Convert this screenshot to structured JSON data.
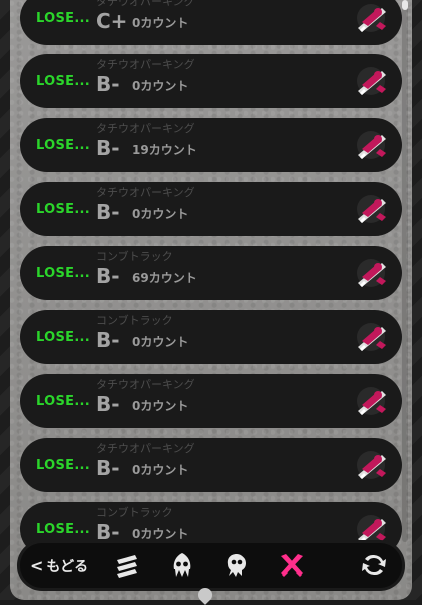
{
  "records": [
    {
      "result": "LOSE...",
      "stage": "タチウオパーキング",
      "rank": "C+",
      "count": "0カウント"
    },
    {
      "result": "LOSE...",
      "stage": "タチウオパーキング",
      "rank": "B-",
      "count": "0カウント"
    },
    {
      "result": "LOSE...",
      "stage": "タチウオパーキング",
      "rank": "B-",
      "count": "19カウント"
    },
    {
      "result": "LOSE...",
      "stage": "タチウオパーキング",
      "rank": "B-",
      "count": "0カウント"
    },
    {
      "result": "LOSE...",
      "stage": "コンブトラック",
      "rank": "B-",
      "count": "69カウント"
    },
    {
      "result": "LOSE...",
      "stage": "コンブトラック",
      "rank": "B-",
      "count": "0カウント"
    },
    {
      "result": "LOSE...",
      "stage": "タチウオパーキング",
      "rank": "B-",
      "count": "0カウント"
    },
    {
      "result": "LOSE...",
      "stage": "タチウオパーキング",
      "rank": "B-",
      "count": "0カウント"
    },
    {
      "result": "LOSE...",
      "stage": "コンブトラック",
      "rank": "B-",
      "count": "0カウント"
    }
  ],
  "toolbar": {
    "back_label": "もどる",
    "back_icon": "chevron-left-icon",
    "tabs": [
      {
        "icon": "stripes-icon",
        "active": false
      },
      {
        "icon": "squid-icon",
        "active": false
      },
      {
        "icon": "octopus-icon",
        "active": false
      },
      {
        "icon": "crossed-weapons-icon",
        "active": true
      },
      {
        "icon": "refresh-icon",
        "active": false
      }
    ]
  },
  "colors": {
    "lose": "#2bd52b",
    "active_tab": "#ff2e8b",
    "weapon": "#c2185b"
  },
  "weapon_icon": "splatling-weapon-icon"
}
